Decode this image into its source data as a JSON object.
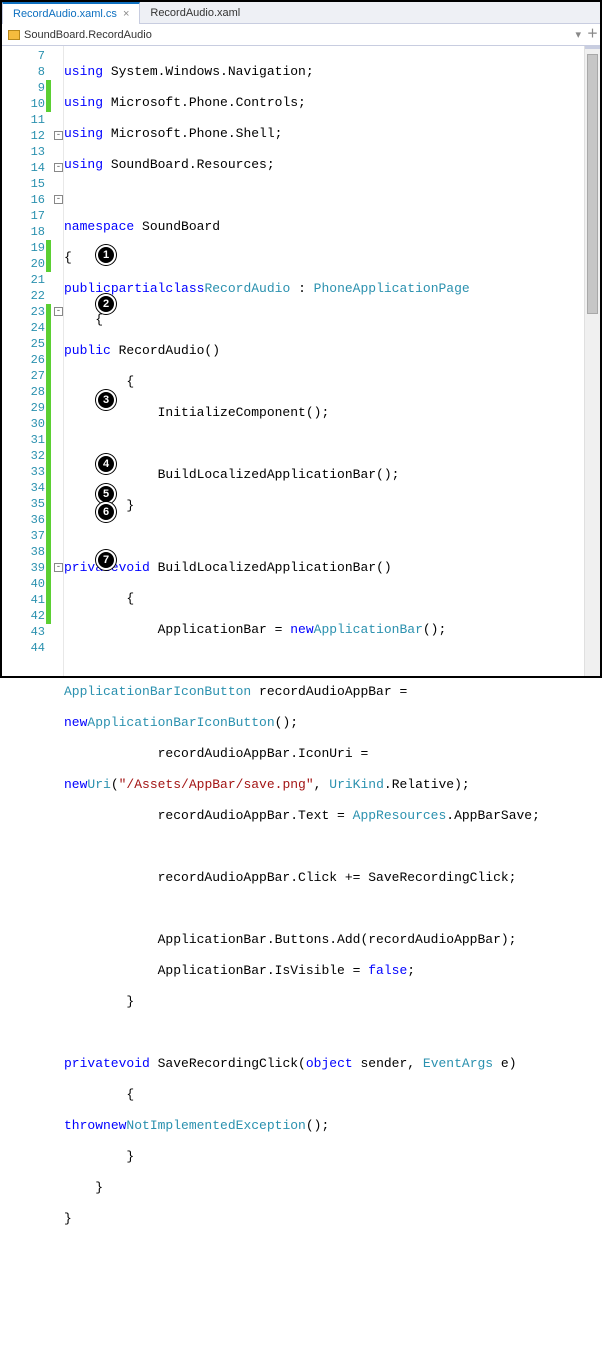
{
  "tabs": {
    "active": "RecordAudio.xaml.cs",
    "inactive": "RecordAudio.xaml"
  },
  "breadcrumb": {
    "path": "SoundBoard.RecordAudio"
  },
  "lines": {
    "l7": {
      "n": "7",
      "t1": "using",
      "t2": " System.Windows.Navigation;"
    },
    "l8": {
      "n": "8",
      "t1": "using",
      "t2": " Microsoft.Phone.Controls;"
    },
    "l9": {
      "n": "9",
      "t1": "using",
      "t2": " Microsoft.Phone.Shell;"
    },
    "l10": {
      "n": "10",
      "t1": "using",
      "t2": " SoundBoard.Resources;"
    },
    "l11": {
      "n": "11"
    },
    "l12": {
      "n": "12",
      "t1": "namespace",
      "t2": " SoundBoard"
    },
    "l13": {
      "n": "13",
      "b": "{"
    },
    "l14": {
      "n": "14",
      "k1": "public",
      "k2": "partial",
      "k3": "class",
      "name": "RecordAudio",
      "base": "PhoneApplicationPage"
    },
    "l15": {
      "n": "15",
      "b": "    {"
    },
    "l16": {
      "n": "16",
      "k1": "public",
      "name": " RecordAudio()"
    },
    "l17": {
      "n": "17",
      "b": "        {"
    },
    "l18": {
      "n": "18",
      "t": "            InitializeComponent();"
    },
    "l19": {
      "n": "19"
    },
    "l20": {
      "n": "20",
      "t": "            BuildLocalizedApplicationBar();"
    },
    "l21": {
      "n": "21",
      "b": "        }"
    },
    "l22": {
      "n": "22"
    },
    "l23": {
      "n": "23",
      "k1": "private",
      "k2": "void",
      "name": " BuildLocalizedApplicationBar()"
    },
    "l24": {
      "n": "24",
      "b": "        {"
    },
    "l25": {
      "n": "25",
      "t1": "            ApplicationBar = ",
      "k": "new",
      "type": "ApplicationBar",
      "t2": "();"
    },
    "l26": {
      "n": "26"
    },
    "l27": {
      "n": "27",
      "type": "ApplicationBarIconButton",
      "t": " recordAudioAppBar ="
    },
    "l28": {
      "n": "28",
      "k": "new",
      "type": "ApplicationBarIconButton",
      "t": "();"
    },
    "l29": {
      "n": "29",
      "t": "            recordAudioAppBar.IconUri ="
    },
    "l30": {
      "n": "30",
      "k": "new",
      "type": "Uri",
      "str": "\"/Assets/AppBar/save.png\"",
      "enum": "UriKind",
      "t": ".Relative);"
    },
    "l31": {
      "n": "31",
      "t1": "            recordAudioAppBar.Text = ",
      "type": "AppResources",
      "t2": ".AppBarSave;"
    },
    "l32": {
      "n": "32"
    },
    "l33": {
      "n": "33",
      "t": "            recordAudioAppBar.Click += SaveRecordingClick;"
    },
    "l34": {
      "n": "34"
    },
    "l35": {
      "n": "35",
      "t": "            ApplicationBar.Buttons.Add(recordAudioAppBar);"
    },
    "l36": {
      "n": "36",
      "t1": "            ApplicationBar.IsVisible = ",
      "k": "false",
      "t2": ";"
    },
    "l37": {
      "n": "37",
      "b": "        }"
    },
    "l38": {
      "n": "38"
    },
    "l39": {
      "n": "39",
      "k1": "private",
      "k2": "void",
      "name": " SaveRecordingClick(",
      "k3": "object",
      "t1": " sender, ",
      "type": "EventArgs",
      "t2": " e)"
    },
    "l40": {
      "n": "40",
      "b": "        {"
    },
    "l41": {
      "n": "41",
      "k1": "throw",
      "k2": "new",
      "type": "NotImplementedException",
      "t": "();"
    },
    "l42": {
      "n": "42",
      "b": "        }"
    },
    "l43": {
      "n": "43",
      "b": "    }"
    },
    "l44": {
      "n": "44",
      "b": "}"
    }
  },
  "badges": {
    "b1": "1",
    "b2": "2",
    "b3": "3",
    "b4": "4",
    "b5": "5",
    "b6": "6",
    "b7": "7"
  }
}
